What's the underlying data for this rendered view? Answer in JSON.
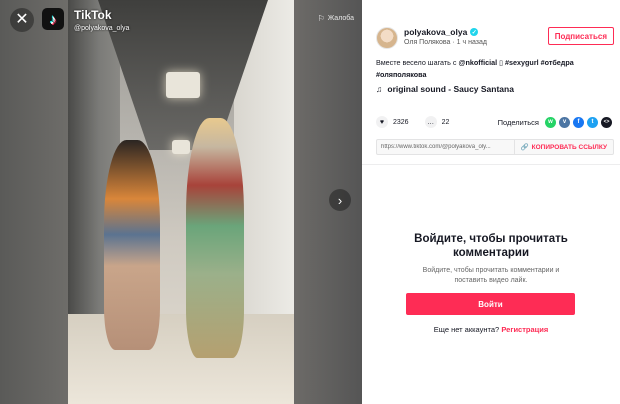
{
  "video": {
    "watermark_logo": "TikTok",
    "watermark_user": "@polyakova_olya",
    "report_label": "Жалоба",
    "report_icon": "flag-icon",
    "close_icon": "close-icon",
    "next_icon": "chevron-right-icon"
  },
  "author": {
    "username": "polyakova_olya",
    "display_name": "Оля Полякова",
    "time_ago": "1 ч назад",
    "separator": "·",
    "follow_label": "Подписаться"
  },
  "caption": {
    "text": "Вместе весело шагать с",
    "mention": "@nkofficial",
    "emoji_box": "▯",
    "tags": [
      "#sexygurl",
      "#отбедра",
      "#оляполякова"
    ]
  },
  "sound": {
    "icon": "music-note-icon",
    "title": "original sound - Saucy Santana"
  },
  "stats": {
    "likes": "2326",
    "comments": "22",
    "share_label": "Поделиться",
    "share_icons": [
      {
        "name": "whatsapp-icon",
        "color": "#25d366",
        "glyph": "w"
      },
      {
        "name": "vk-icon",
        "color": "#4c75a3",
        "glyph": "v"
      },
      {
        "name": "facebook-icon",
        "color": "#1877f2",
        "glyph": "f"
      },
      {
        "name": "twitter-icon",
        "color": "#1da1f2",
        "glyph": "t"
      },
      {
        "name": "embed-icon",
        "color": "#161823",
        "glyph": "<>"
      }
    ]
  },
  "link": {
    "url": "https://www.tiktok.com/@polyakova_oly...",
    "copy_label": "КОПИРОВАТЬ ССЫЛКУ"
  },
  "login": {
    "title": "Войдите, чтобы прочитать комментарии",
    "subtitle": "Войдите, чтобы прочитать комментарии и поставить видео лайк.",
    "button": "Войти",
    "no_account": "Еще нет аккаунта?",
    "signup_link": "Регистрация"
  },
  "colors": {
    "accent": "#fe2c55",
    "verified": "#20d5ec"
  }
}
